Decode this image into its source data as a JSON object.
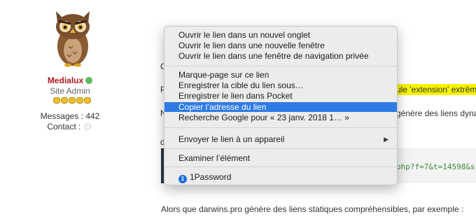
{
  "user": {
    "name": "Medialux",
    "role": "Site Admin",
    "messages_label": "Messages :",
    "messages_value": "442",
    "contact_label": "Contact :",
    "online_color": "#5cb85c",
    "name_color": "#b0171f"
  },
  "post": {
    "left_fragments": [
      "C",
      "P",
      "N",
      "d"
    ],
    "highlight_fragment": "ule 'extension' extrêm",
    "right_fragment": "génère des liens dynam",
    "code_fragment": "php?f=7&t=14598&s",
    "bottom_text": "Alors que darwins.pro génère des liens statiques compréhensibles, par exemple :",
    "highlight_color": "#f8f300"
  },
  "context_menu": {
    "groups": [
      [
        "Ouvrir le lien dans un nouvel onglet",
        "Ouvrir le lien dans une nouvelle fenêtre",
        "Ouvrir le lien dans une fenêtre de navigation privée"
      ],
      [
        "Marque-page sur ce lien",
        "Enregistrer la cible du lien sous…",
        "Enregistrer le lien dans Pocket",
        "Copier l’adresse du lien",
        "Recherche Google pour « 23 janv. 2018 1… »"
      ],
      [
        "Envoyer le lien à un appareil"
      ],
      [
        "Examiner l’élément"
      ],
      [
        "1Password"
      ]
    ],
    "selected_item": "Copier l’adresse du lien",
    "selection_color": "#2f7be6",
    "submenu_arrow_icon": "triangle-right-icon",
    "password_icon": "1password-icon"
  }
}
